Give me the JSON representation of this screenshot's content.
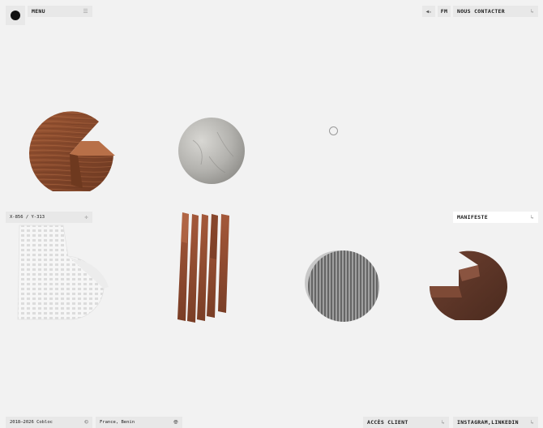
{
  "header": {
    "menu_label": "MENU",
    "menu_icon": "hamburger-icon",
    "sound_icon": "speaker-icon",
    "sound_mark": "✕",
    "fm_label": "FM",
    "contact_label": "NOUS CONTACTER",
    "contact_icon": "corner-arrow-icon"
  },
  "coords": {
    "text": "X-856 / Y-313",
    "icon": "crosshair-icon"
  },
  "manifeste": {
    "label": "MANIFESTE",
    "icon": "corner-arrow-icon"
  },
  "footer": {
    "copyright": "2018—2026 Cobloc",
    "copyright_icon": "copyright-icon",
    "location": "France, Benin",
    "location_icon": "globe-icon",
    "client_label": "ACCÈS CLIENT",
    "client_icon": "corner-arrow-icon",
    "social_label": "INSTAGRAM,LINKEDIN",
    "social_icon": "corner-arrow-icon"
  },
  "objects": [
    {
      "name": "wood-pacman",
      "material": "wood"
    },
    {
      "name": "stone-sphere",
      "material": "stone"
    },
    {
      "name": "white-grid-sculpture",
      "material": "white"
    },
    {
      "name": "wood-slats",
      "material": "wood"
    },
    {
      "name": "ribbed-stone-disc",
      "material": "stone"
    },
    {
      "name": "dark-wood-pacman",
      "material": "wood"
    }
  ],
  "colors": {
    "background": "#f2f2f2",
    "chip": "#e8e8e8",
    "wood": "#8a4a2c",
    "stone": "#b5b5b2",
    "dark_wood": "#5c3626"
  }
}
